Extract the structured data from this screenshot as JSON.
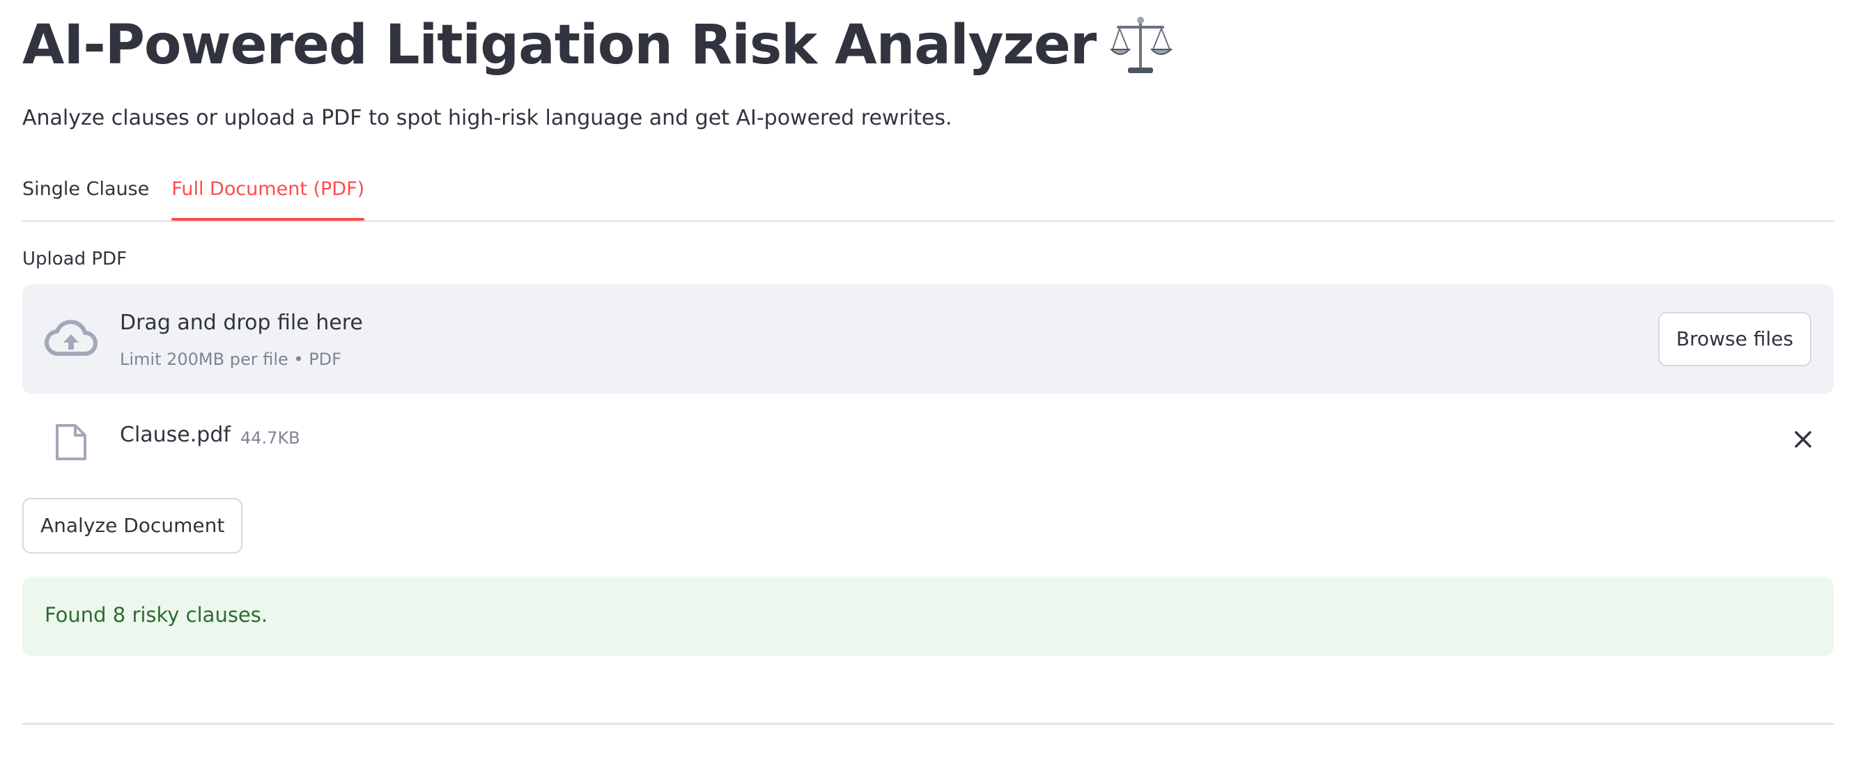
{
  "page": {
    "title": "AI-Powered Litigation Risk Analyzer",
    "title_icon": "balance-scale-emoji",
    "subtitle": "Analyze clauses or upload a PDF to spot high-risk language and get AI-powered rewrites."
  },
  "tabs": [
    {
      "label": "Single Clause",
      "active": false
    },
    {
      "label": "Full Document (PDF)",
      "active": true
    }
  ],
  "uploader": {
    "label": "Upload PDF",
    "dropzone_title": "Drag and drop file here",
    "dropzone_limit": "Limit 200MB per file • PDF",
    "browse_label": "Browse files",
    "icon": "cloud-upload-icon"
  },
  "uploaded_file": {
    "name": "Clause.pdf",
    "size": "44.7KB",
    "icon": "file-icon"
  },
  "actions": {
    "analyze_label": "Analyze Document"
  },
  "result": {
    "message": "Found 8 risky clauses."
  },
  "colors": {
    "accent": "#ff4b4b",
    "text": "#31333f",
    "muted": "#808495",
    "dropzone_bg": "#f0f2f6",
    "success_bg": "#edf7ee",
    "success_text": "#2e6b30"
  }
}
